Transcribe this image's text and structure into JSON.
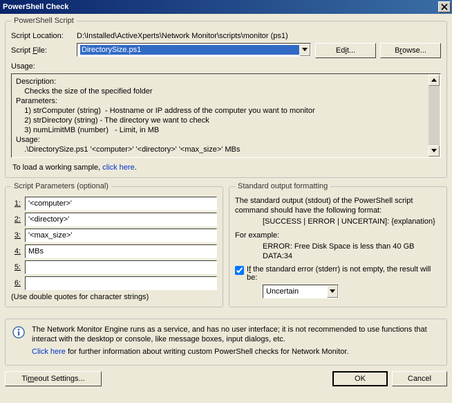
{
  "window": {
    "title": "PowerShell Check"
  },
  "groups": {
    "script": "PowerShell Script",
    "params": "Script Parameters (optional)",
    "stdout": "Standard output formatting"
  },
  "labels": {
    "location": "Script Location:",
    "file_pre": "Script ",
    "file_key": "F",
    "file_post": "ile:",
    "usage": "Usage:"
  },
  "values": {
    "location_path": "D:\\Installed\\ActiveXperts\\Network Monitor\\scripts\\monitor (ps1)",
    "script_file": "DirectorySize.ps1"
  },
  "buttons": {
    "edit_pre": "Ed",
    "edit_key": "i",
    "edit_post": "t...",
    "browse_pre": "B",
    "browse_key": "r",
    "browse_post": "owse...",
    "timeout_pre": "Ti",
    "timeout_key": "m",
    "timeout_post": "eout Settings...",
    "ok": "OK",
    "cancel": "Cancel"
  },
  "usage_lines": [
    "Description:",
    "    Checks the size of the specified folder",
    "Parameters:",
    "    1) strComputer (string)  - Hostname or IP address of the computer you want to monitor",
    "    2) strDirectory (string) - The directory we want to check",
    "    3) numLimitMB (number)   - Limit, in MB",
    "Usage:",
    "    .\\DirectorySize.ps1 '<computer>' '<directory>' '<max_size>' MBs"
  ],
  "sample": {
    "prefix": "To load a working sample, ",
    "link": "click here",
    "suffix": "."
  },
  "params": {
    "1": "'<computer>'",
    "2": "'<directory>'",
    "3": "'<max_size>'",
    "4": "MBs",
    "5": "",
    "6": "",
    "note": "(Use double quotes for character strings)"
  },
  "stdout": {
    "l1": "The standard output (stdout) of the PowerShell script command should have the following format:",
    "l2": "[SUCCESS | ERROR | UNCERTAIN]: {explanation}",
    "l3": "For example:",
    "l4": "ERROR: Free Disk Space is less than 40 GB DATA:34",
    "check_pre": "I",
    "check_key": "f",
    "check_post": " the standard error (stderr) is not empty, the result will be:",
    "stderr_result": "Uncertain",
    "checked": true
  },
  "info": {
    "l1": "The Network Monitor Engine runs as a service, and has no user interface; it is not recommended to use functions that interact with the desktop or console, like message boxes, input dialogs, etc.",
    "link": "Click here",
    "l2_post": " for further information about writing custom PowerShell checks for Network Monitor."
  }
}
